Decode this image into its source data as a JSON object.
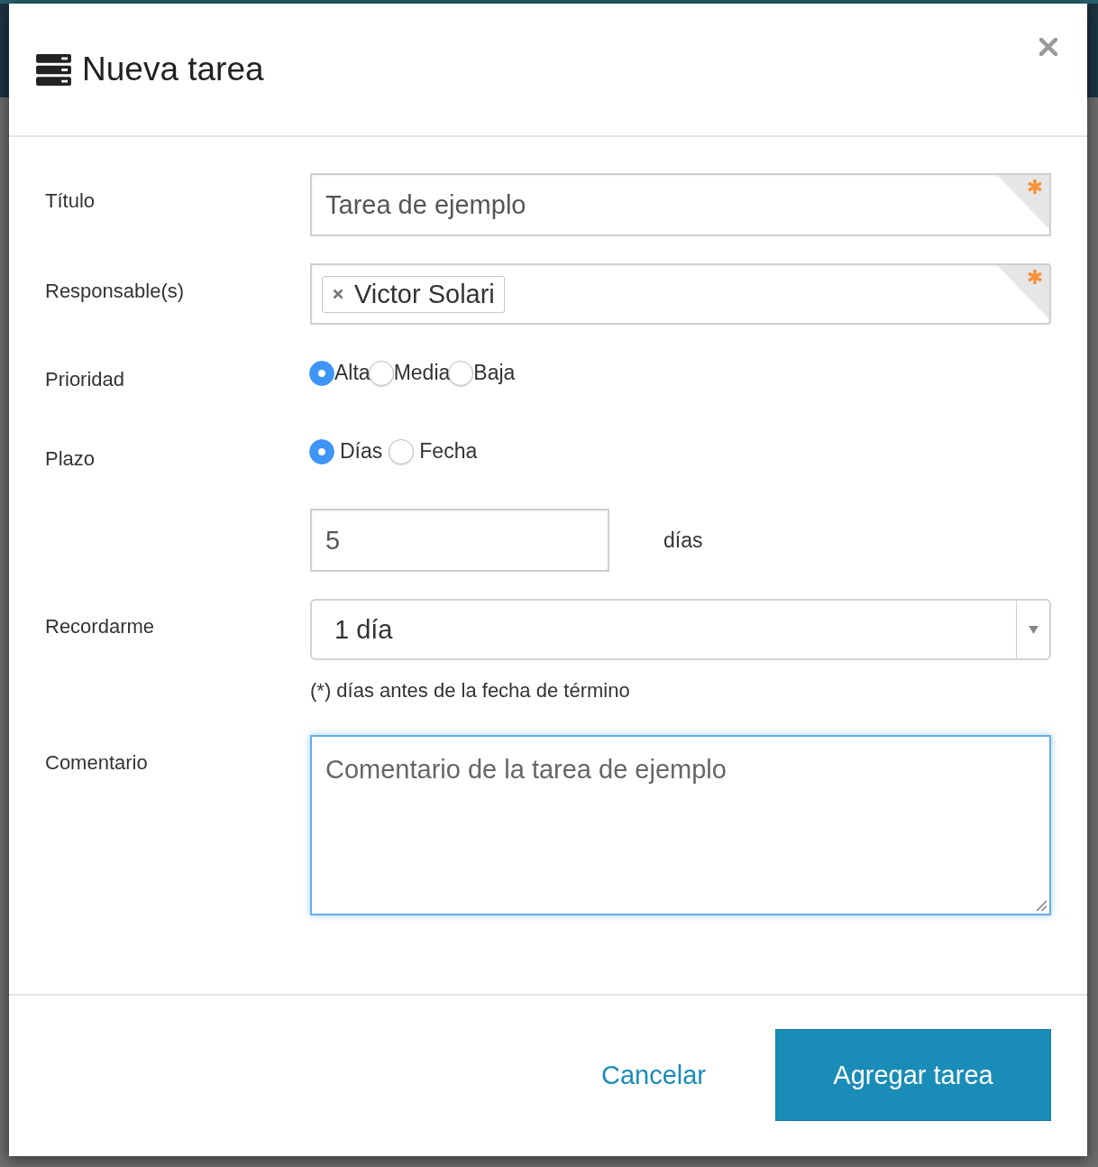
{
  "dialog": {
    "title": "Nueva tarea"
  },
  "form": {
    "title_field": {
      "label": "Título",
      "value": "Tarea de ejemplo",
      "required": true
    },
    "assignees": {
      "label": "Responsable(s)",
      "tags": [
        {
          "label": "Victor Solari"
        }
      ],
      "required": true
    },
    "priority": {
      "label": "Prioridad",
      "options": [
        {
          "label": "Alta",
          "selected": true
        },
        {
          "label": "Media",
          "selected": false
        },
        {
          "label": "Baja",
          "selected": false
        }
      ]
    },
    "deadline": {
      "label": "Plazo",
      "options": [
        {
          "label": "Días",
          "selected": true
        },
        {
          "label": "Fecha",
          "selected": false
        }
      ],
      "value": "5",
      "unit": "días"
    },
    "reminder": {
      "label": "Recordarme",
      "value": "1 día",
      "hint": "(*) días antes de la fecha de término"
    },
    "comment": {
      "label": "Comentario",
      "value": "Comentario de la tarea de ejemplo",
      "focused": true
    }
  },
  "footer": {
    "cancel": "Cancelar",
    "submit": "Agregar tarea"
  }
}
